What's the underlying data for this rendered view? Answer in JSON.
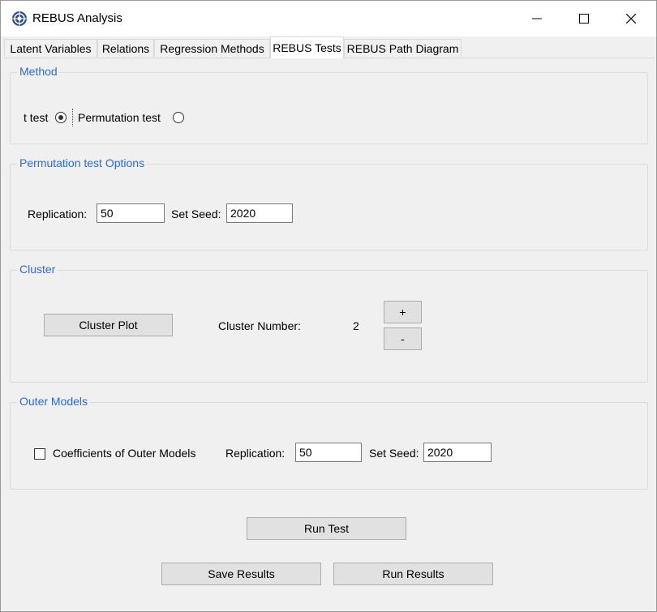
{
  "window": {
    "title": "REBUS Analysis",
    "icon": "rebus-app-icon",
    "controls": {
      "minimize": "minimize-icon",
      "maximize": "maximize-icon",
      "close": "close-icon"
    }
  },
  "tabs": [
    {
      "label": "Latent Variables",
      "active": false
    },
    {
      "label": "Relations",
      "active": false
    },
    {
      "label": "Regression Methods",
      "active": false
    },
    {
      "label": "REBUS Tests",
      "active": true
    },
    {
      "label": "REBUS Path Diagram",
      "active": false
    }
  ],
  "method": {
    "title": "Method",
    "t_test_label": "t test",
    "t_test_selected": true,
    "permutation_label": "Permutation test",
    "permutation_selected": false
  },
  "permutation_options": {
    "title": "Permutation test Options",
    "replication_label": "Replication:",
    "replication_value": "50",
    "seed_label": "Set Seed:",
    "seed_value": "2020"
  },
  "cluster": {
    "title": "Cluster",
    "plot_button": "Cluster Plot",
    "number_label": "Cluster Number:",
    "number_value": "2",
    "plus_button": "+",
    "minus_button": "-"
  },
  "outer_models": {
    "title": "Outer Models",
    "checkbox_label": "Coefficients of Outer Models",
    "checked": false,
    "replication_label": "Replication:",
    "replication_value": "50",
    "seed_label": "Set Seed:",
    "seed_value": "2020"
  },
  "actions": {
    "run_test": "Run Test",
    "save_results": "Save Results",
    "run_results": "Run Results"
  },
  "colors": {
    "group_title": "#2b6bd6",
    "panel_bg": "#f0f0f0",
    "button_bg": "#e1e1e1"
  }
}
